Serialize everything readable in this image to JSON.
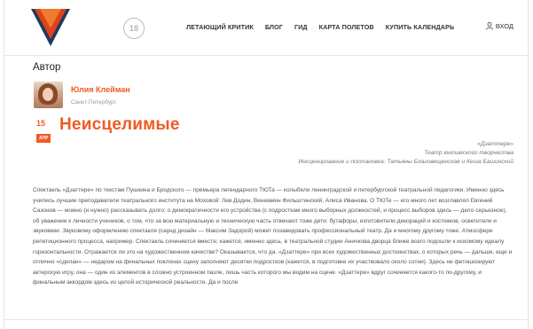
{
  "header": {
    "badge": "18",
    "nav": [
      "ЛЕТАЮЩИЙ КРИТИК",
      "БЛОГ",
      "ГИД",
      "КАРТА ПОЛЕТОВ",
      "КУПИТЬ КАЛЕНДАРЬ"
    ],
    "login_label": "ВХОД",
    "logo_icon": "logo-icon",
    "user_icon": "user-icon",
    "accent_color": "#f05a22"
  },
  "section_title": "Автор",
  "author": {
    "name": "Юлия Клейман",
    "city": "Санкт-Петербург"
  },
  "post": {
    "day": "15",
    "month": "АПР",
    "title": "Неисцелимые"
  },
  "credits": [
    "«Дзаттере»",
    "Театр юношеского творчества",
    "Инсценирование и постановка: Татьяны Благовещенская и Кеша Башинский"
  ],
  "article": "Спектакль «Дзаттере» по текстам Пушкина и Бродского — премьера легендарного ТЮТа — колыбели ленинградской и петербургской театральной педагогики. Именно здесь учились лучшие преподаватели театрального института на Моховой: Лев Додин, Вениамин Фильштинский, Алиса Иванова. О ТЮТе — его много лет возглавлял Евгений Сазонов — можно (и нужно) рассказывать долго: о демократичности его устройства (с подросткам много выборных должностей, и процесс выборов здесь — дело серьезное), об уважении к личности учеников, о том, что за всю материальную и техническую часть отвечают тоже дети: бутафоры, изготовители декораций и костюмов, осветители и звуковики. Звуковому оформлению спектакля (саунд дизайн — Максим Задорой) может позавидовать профессиональный театр. Да и многому другому тоже. Атмосфере репетиционного процесса, например. Спектакль сочиняется вместе; кажется, именно здесь, в театральной студии Аничкова дворца ближе всего подошли к искомому идеалу горизонтальности. Отражается ли это на художественном качестве? Оказывается, что да. «Дзаттере» при всех художественных достоинствах, о которых речь — дальше, еще и отлично «сделан» — недаром на финальных поклонах сцену заполняют десятки подростков (кажется, в подготовке их участвовало около сотни). Здесь не фетишизируют актерскую игру, она — один из элементов в сложно устроенном пазле, лишь часть которого мы видим на сцене. «Дзаттере» вдруг сочиняется какого-то по-другому, и финальным аккордом здесь из целой исторической реальности. Да и после"
}
